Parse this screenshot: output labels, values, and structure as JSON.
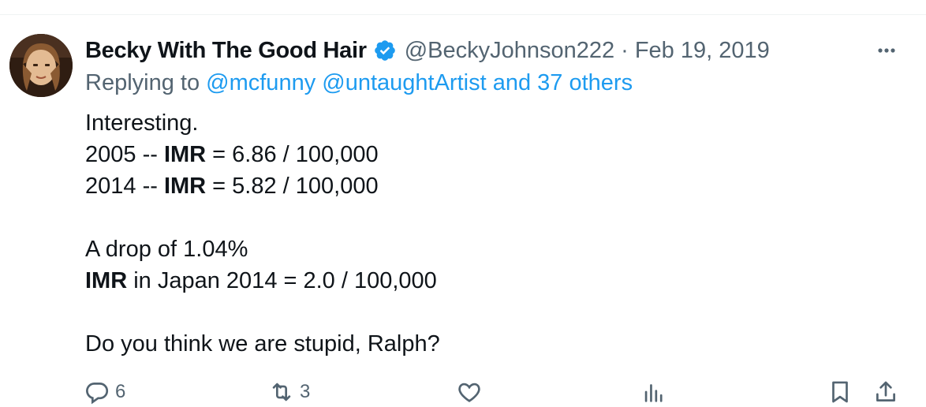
{
  "tweet": {
    "display_name": "Becky With The Good Hair",
    "handle": "@BeckyJohnson222",
    "separator": "·",
    "date": "Feb 19, 2019",
    "replying_prefix": "Replying to ",
    "replying_mentions": [
      "@mcfunny",
      "@untaughtArtist"
    ],
    "replying_suffix": "and 37 others",
    "lines": [
      {
        "pre": "Interesting.",
        "bold": "",
        "post": ""
      },
      {
        "pre": "2005 -- ",
        "bold": "IMR",
        "post": " = 6.86 / 100,000"
      },
      {
        "pre": "2014 -- ",
        "bold": "IMR",
        "post": " = 5.82 / 100,000"
      },
      {
        "pre": "",
        "bold": "",
        "post": ""
      },
      {
        "pre": "A drop of 1.04%",
        "bold": "",
        "post": ""
      },
      {
        "pre": "",
        "bold": "IMR",
        "post": " in Japan 2014 = 2.0 / 100,000"
      },
      {
        "pre": "",
        "bold": "",
        "post": ""
      },
      {
        "pre": "Do you think we are stupid, Ralph?",
        "bold": "",
        "post": ""
      }
    ]
  },
  "actions": {
    "replies": "6",
    "retweets": "3",
    "icons": [
      "reply-icon",
      "retweet-icon",
      "like-icon",
      "views-icon",
      "bookmark-icon",
      "share-icon"
    ]
  },
  "colors": {
    "accent": "#1d9bf0",
    "muted": "#536471",
    "text": "#0f1419"
  }
}
